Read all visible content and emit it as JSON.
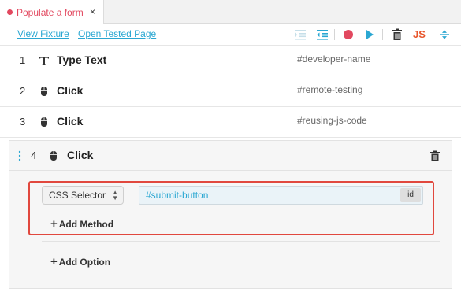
{
  "tab": {
    "title": "Populate a form",
    "close": "×",
    "dot_color": "#e2485f"
  },
  "toolbar": {
    "view_fixture": "View Fixture",
    "open_tested_page": "Open Tested Page",
    "js_label": "JS",
    "icons": [
      "indent-list-icon",
      "outdent-list-icon",
      "record-icon",
      "play-icon",
      "clear-all-icon",
      "js-export-icon",
      "collapse-icon"
    ],
    "accent": "#2aa7d2",
    "record_color": "#e2485f",
    "js_color": "#e8552b"
  },
  "commands": [
    {
      "number": "1",
      "name": "Type Text",
      "icon": "type-text-icon",
      "selector": "#developer-name"
    },
    {
      "number": "2",
      "name": "Click",
      "icon": "mouse-icon",
      "selector": "#remote-testing"
    },
    {
      "number": "3",
      "name": "Click",
      "icon": "mouse-icon",
      "selector": "#reusing-js-code"
    }
  ],
  "expanded": {
    "number": "4",
    "name": "Click",
    "icon": "mouse-icon",
    "method": "CSS Selector",
    "selector_value": "#submit-button",
    "badge": "id",
    "add_method": "Add Method",
    "add_option": "Add Option",
    "highlight_color": "#e1483e"
  }
}
